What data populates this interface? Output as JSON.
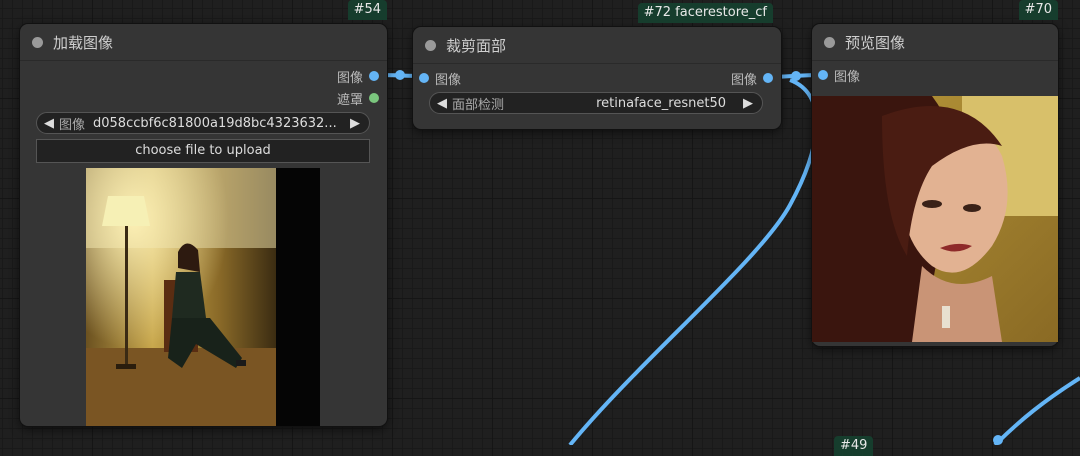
{
  "nodes": {
    "load_image": {
      "id": "#54",
      "title": "加载图像",
      "outputs": [
        "图像",
        "遮罩"
      ],
      "image_widget": {
        "label": "图像",
        "value": "d058ccbf6c81800a19d8bc4323632..."
      },
      "upload_label": "choose file to upload",
      "preview_icon": "photo-woman-seated-lamp"
    },
    "face_crop": {
      "id": "#72 facerestore_cf",
      "title": "裁剪面部",
      "input": "图像",
      "output": "图像",
      "detector_widget": {
        "label": "面部检测",
        "value": "retinaface_resnet50"
      }
    },
    "preview": {
      "id": "#70",
      "title": "预览图像",
      "input": "图像",
      "preview_icon": "photo-face-portrait"
    },
    "partial_node": {
      "id": "#49"
    }
  },
  "colors": {
    "link": "#64b5f6",
    "badge": "#163d2d",
    "mask": "#7bc67e"
  }
}
